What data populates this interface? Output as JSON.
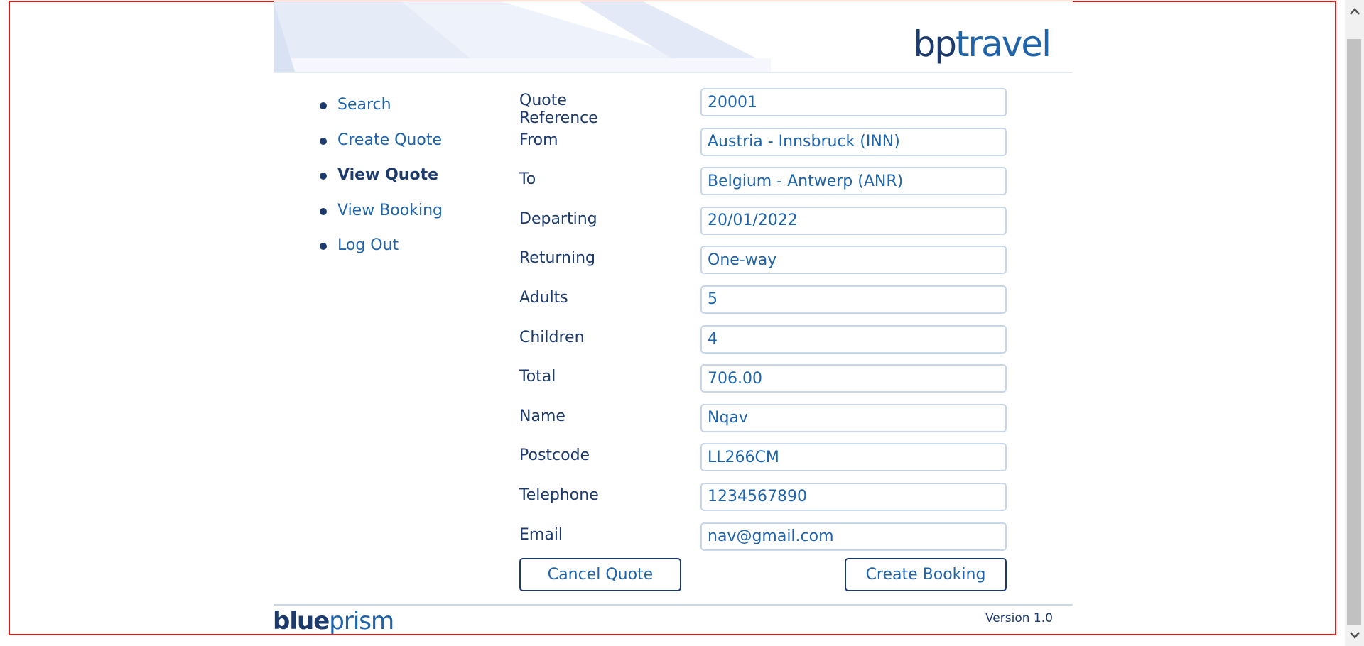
{
  "app": {
    "logo_bp": "bp",
    "logo_travel": "travel"
  },
  "nav": {
    "items": [
      {
        "label": "Search",
        "active": false
      },
      {
        "label": "Create Quote",
        "active": false
      },
      {
        "label": "View Quote",
        "active": true
      },
      {
        "label": "View Booking",
        "active": false
      },
      {
        "label": "Log Out",
        "active": false
      }
    ]
  },
  "form": {
    "fields": [
      {
        "label": "Quote Reference",
        "value": "20001"
      },
      {
        "label": "From",
        "value": "Austria - Innsbruck (INN)"
      },
      {
        "label": "To",
        "value": "Belgium - Antwerp (ANR)"
      },
      {
        "label": "Departing",
        "value": "20/01/2022"
      },
      {
        "label": "Returning",
        "value": "One-way"
      },
      {
        "label": "Adults",
        "value": "5"
      },
      {
        "label": "Children",
        "value": "4"
      },
      {
        "label": "Total",
        "value": "706.00"
      },
      {
        "label": "Name",
        "value": "Nqav"
      },
      {
        "label": "Postcode",
        "value": "LL266CM"
      },
      {
        "label": "Telephone",
        "value": "1234567890"
      },
      {
        "label": "Email",
        "value": "nav@gmail.com"
      }
    ]
  },
  "actions": {
    "cancel_label": "Cancel Quote",
    "create_label": "Create Booking"
  },
  "footer": {
    "logo_blue": "blue",
    "logo_prism": "prism",
    "version": "Version 1.0"
  },
  "colors": {
    "brand_dark": "#1c3a6c",
    "brand_blue": "#1f64aa",
    "frame_border": "#e0191b"
  }
}
